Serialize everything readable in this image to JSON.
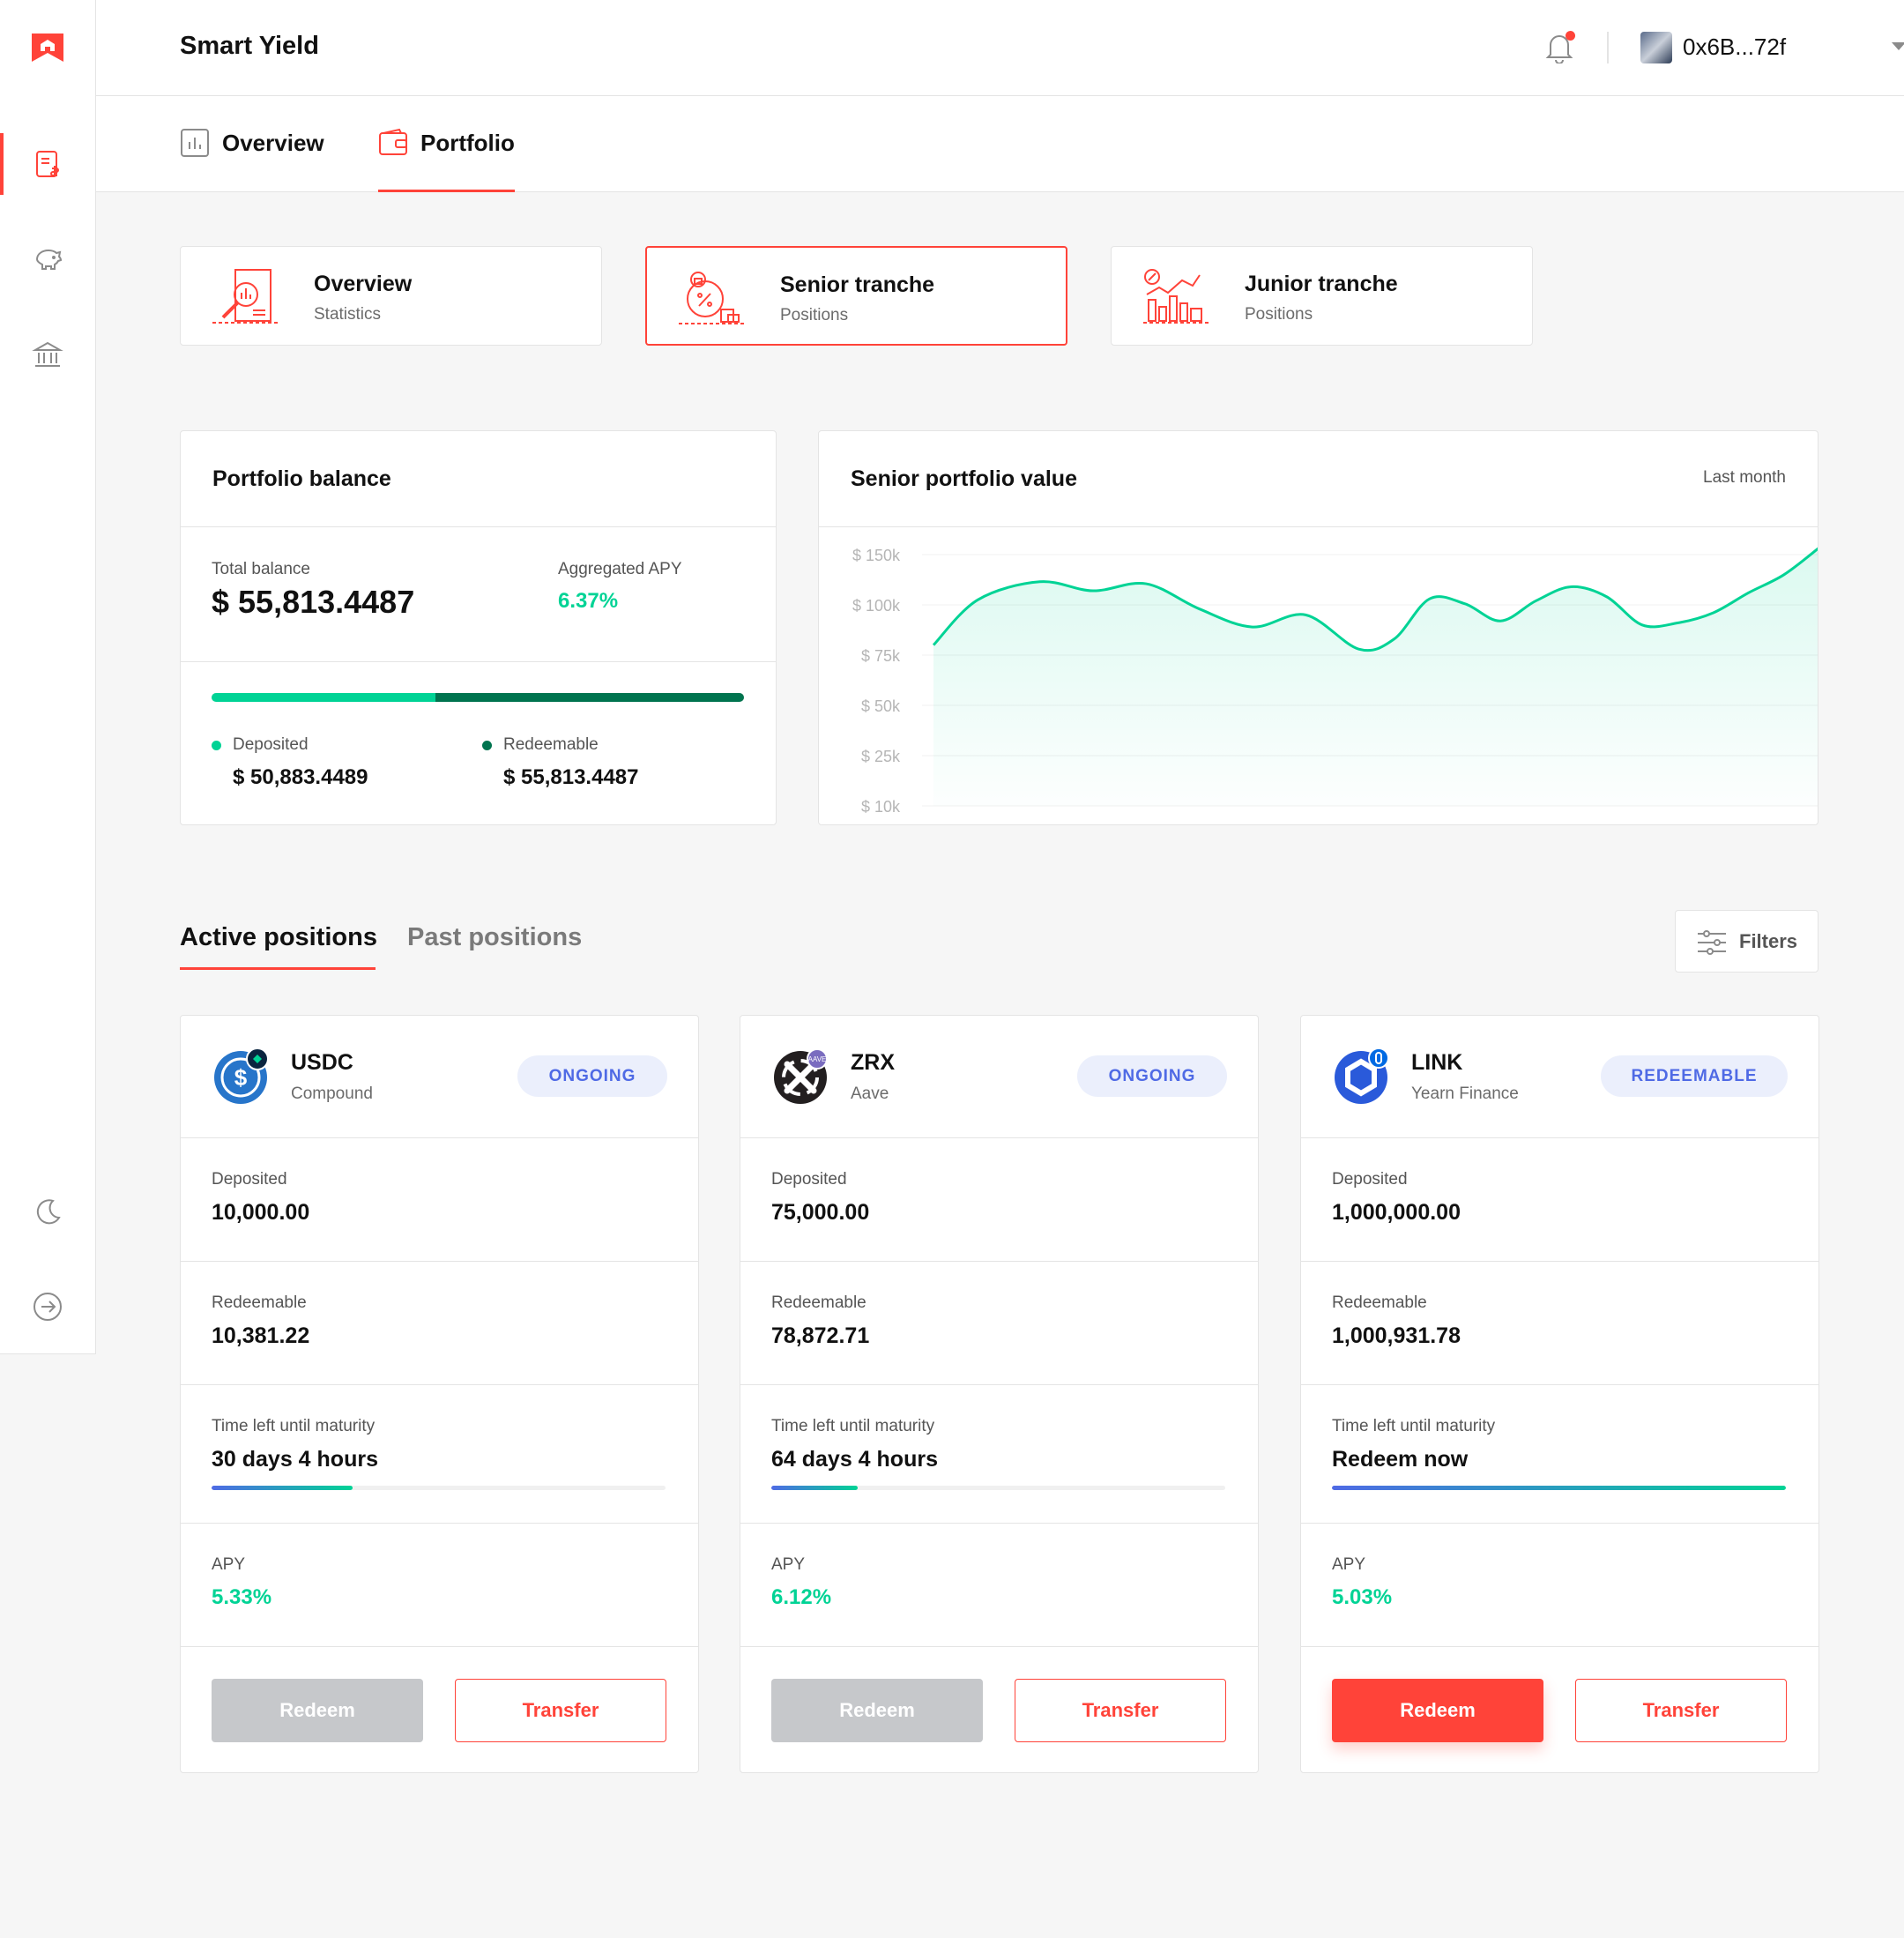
{
  "app": {
    "title": "Smart Yield",
    "wallet": "0x6B...72f"
  },
  "sidebar": {
    "items": [
      {
        "name": "pools-icon",
        "active": true
      },
      {
        "name": "piggy-bank-icon",
        "active": false
      },
      {
        "name": "bank-icon",
        "active": false
      }
    ],
    "bottom": [
      {
        "name": "moon-icon"
      },
      {
        "name": "logout-icon"
      }
    ]
  },
  "subnav": {
    "tabs": [
      {
        "label": "Overview"
      },
      {
        "label": "Portfolio",
        "active": true
      }
    ]
  },
  "categories": [
    {
      "title": "Overview",
      "subtitle": "Statistics"
    },
    {
      "title": "Senior tranche",
      "subtitle": "Positions",
      "active": true
    },
    {
      "title": "Junior tranche",
      "subtitle": "Positions"
    }
  ],
  "balance": {
    "title": "Portfolio balance",
    "total_label": "Total balance",
    "total_value": "$ 55,813.4487",
    "apy_label": "Aggregated APY",
    "apy_value": "6.37%",
    "deposited_fraction": 0.42,
    "deposited_label": "Deposited",
    "deposited_value": "$ 50,883.4489",
    "redeemable_label": "Redeemable",
    "redeemable_value": "$ 55,813.4487",
    "colors": {
      "deposited": "#00d395",
      "redeemable": "#00744f"
    }
  },
  "value_chart": {
    "title": "Senior portfolio value",
    "period": "Last month"
  },
  "chart_data": {
    "type": "area",
    "title": "Senior portfolio value",
    "yticks": [
      "$ 150k",
      "$ 100k",
      "$ 75k",
      "$ 50k",
      "$ 25k",
      "$ 10k"
    ],
    "tick_values": [
      150,
      100,
      75,
      50,
      25,
      10
    ],
    "x": [
      0,
      0.05,
      0.12,
      0.18,
      0.24,
      0.3,
      0.36,
      0.42,
      0.48,
      0.52,
      0.56,
      0.6,
      0.64,
      0.68,
      0.72,
      0.76,
      0.8,
      0.84,
      0.88,
      0.92,
      0.96,
      1
    ],
    "values": [
      80,
      105,
      123,
      114,
      121,
      98,
      89,
      95,
      78,
      83,
      106,
      101,
      92,
      104,
      118,
      108,
      90,
      91,
      96,
      112,
      130,
      157
    ],
    "color": "#00d395",
    "grid": true
  },
  "positions": {
    "tabs": [
      {
        "label": "Active positions",
        "active": true
      },
      {
        "label": "Past positions"
      }
    ],
    "filters_label": "Filters",
    "cards": [
      {
        "token": "USDC",
        "protocol": "Compound",
        "status": "ONGOING",
        "deposited_label": "Deposited",
        "deposited": "10,000.00",
        "redeemable_label": "Redeemable",
        "redeemable": "10,381.22",
        "maturity_label": "Time left until maturity",
        "maturity": "30 days 4 hours",
        "progress": 0.31,
        "apy_label": "APY",
        "apy": "5.33%",
        "redeem_label": "Redeem",
        "redeem_enabled": false,
        "transfer_label": "Transfer"
      },
      {
        "token": "ZRX",
        "protocol": "Aave",
        "status": "ONGOING",
        "deposited_label": "Deposited",
        "deposited": "75,000.00",
        "redeemable_label": "Redeemable",
        "redeemable": "78,872.71",
        "maturity_label": "Time left until maturity",
        "maturity": "64 days 4 hours",
        "progress": 0.19,
        "apy_label": "APY",
        "apy": "6.12%",
        "redeem_label": "Redeem",
        "redeem_enabled": false,
        "transfer_label": "Transfer"
      },
      {
        "token": "LINK",
        "protocol": "Yearn Finance",
        "status": "REDEEMABLE",
        "deposited_label": "Deposited",
        "deposited": "1,000,000.00",
        "redeemable_label": "Redeemable",
        "redeemable": "1,000,931.78",
        "maturity_label": "Time left until maturity",
        "maturity": "Redeem now",
        "progress": 1.0,
        "apy_label": "APY",
        "apy": "5.03%",
        "redeem_label": "Redeem",
        "redeem_enabled": true,
        "transfer_label": "Transfer"
      }
    ]
  },
  "colors": {
    "accent": "#ff4339",
    "green": "#00d395",
    "blue": "#4f6ae5"
  }
}
